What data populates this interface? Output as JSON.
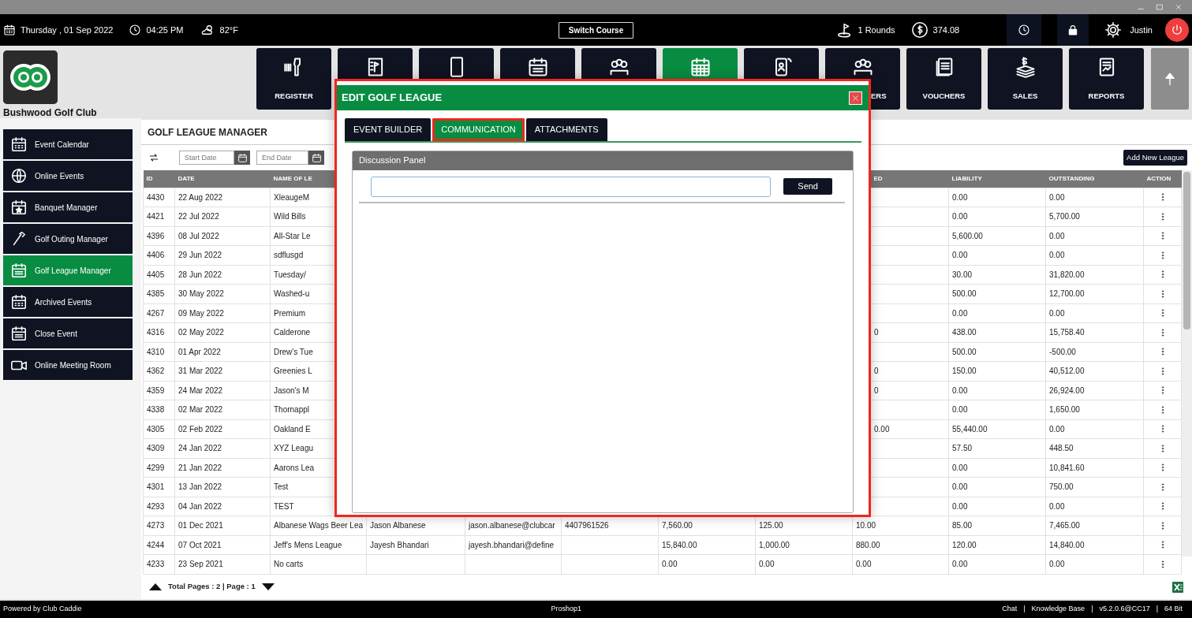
{
  "top_bar": {
    "date": "Thursday , 01 Sep 2022",
    "time": "04:25 PM",
    "temperature": "82°F",
    "switch_button": "Switch Course",
    "rounds": "1 Rounds",
    "balance": "374.08",
    "user": "Justin"
  },
  "club": {
    "name": "Bushwood Golf Club"
  },
  "nav_tiles": [
    {
      "label": "REGISTER",
      "selected": false
    },
    {
      "selected": false
    },
    {
      "selected": false
    },
    {
      "selected": false
    },
    {
      "selected": false
    },
    {
      "selected": true
    },
    {
      "selected": false
    },
    {
      "label": "ERS",
      "selected": false
    },
    {
      "label": "VOUCHERS",
      "selected": false
    },
    {
      "label": "SALES",
      "selected": false
    },
    {
      "label": "REPORTS",
      "selected": false
    }
  ],
  "sidebar": {
    "items": [
      {
        "label": "Event Calendar",
        "selected": false
      },
      {
        "label": "Online Events",
        "selected": false
      },
      {
        "label": "Banquet Manager",
        "selected": false
      },
      {
        "label": "Golf Outing Manager",
        "selected": false
      },
      {
        "label": "Golf League Manager",
        "selected": true
      },
      {
        "label": "Archived Events",
        "selected": false
      },
      {
        "label": "Close Event",
        "selected": false
      },
      {
        "label": "Online Meeting Room",
        "selected": false
      }
    ]
  },
  "panel": {
    "title": "GOLF LEAGUE MANAGER",
    "start_date": {
      "placeholder": "Start Date"
    },
    "end_date": {
      "placeholder": "End Date"
    },
    "add_button": "Add New League"
  },
  "table": {
    "columns": [
      "ID",
      "DATE",
      "NAME OF LE",
      null,
      null,
      null,
      null,
      null,
      "ED",
      "LIABILITY",
      "OUTSTANDING",
      "ACTION"
    ],
    "rows": [
      {
        "cells": [
          "4430",
          "22 Aug 2022",
          "XleaugeM",
          null,
          null,
          null,
          null,
          null,
          null,
          "0.00",
          "0.00"
        ]
      },
      {
        "cells": [
          "4421",
          "22 Jul 2022",
          "Wild Bills",
          null,
          null,
          null,
          null,
          null,
          null,
          "0.00",
          "5,700.00"
        ]
      },
      {
        "cells": [
          "4396",
          "08 Jul 2022",
          "All-Star Le",
          null,
          null,
          null,
          null,
          null,
          null,
          "5,600.00",
          "0.00"
        ]
      },
      {
        "cells": [
          "4406",
          "29 Jun 2022",
          "sdflusgd",
          null,
          null,
          null,
          null,
          null,
          null,
          "0.00",
          "0.00"
        ]
      },
      {
        "cells": [
          "4405",
          "28 Jun 2022",
          "Tuesday/",
          null,
          null,
          null,
          null,
          null,
          null,
          "30.00",
          "31,820.00"
        ]
      },
      {
        "cells": [
          "4385",
          "30 May 2022",
          "Washed-u",
          null,
          null,
          null,
          null,
          null,
          null,
          "500.00",
          "12,700.00"
        ]
      },
      {
        "cells": [
          "4267",
          "09 May 2022",
          "Premium",
          null,
          null,
          null,
          null,
          null,
          null,
          "0.00",
          "0.00"
        ]
      },
      {
        "cells": [
          "4316",
          "02 May 2022",
          "Calderone",
          null,
          null,
          null,
          null,
          null,
          "0",
          "438.00",
          "15,758.40"
        ]
      },
      {
        "cells": [
          "4310",
          "01 Apr 2022",
          "Drew's Tue",
          null,
          null,
          null,
          null,
          null,
          null,
          "500.00",
          "-500.00"
        ]
      },
      {
        "cells": [
          "4362",
          "31 Mar 2022",
          "Greenies L",
          null,
          null,
          null,
          null,
          null,
          "0",
          "150.00",
          "40,512.00"
        ]
      },
      {
        "cells": [
          "4359",
          "24 Mar 2022",
          "Jason's M",
          null,
          null,
          null,
          null,
          null,
          "0",
          "0.00",
          "26,924.00"
        ]
      },
      {
        "cells": [
          "4338",
          "02 Mar 2022",
          "Thornappl",
          null,
          null,
          null,
          null,
          null,
          null,
          "0.00",
          "1,650.00"
        ]
      },
      {
        "cells": [
          "4305",
          "02 Feb 2022",
          "Oakland E",
          null,
          null,
          null,
          null,
          null,
          "0.00",
          "55,440.00",
          "0.00"
        ]
      },
      {
        "cells": [
          "4309",
          "24 Jan 2022",
          "XYZ Leagu",
          null,
          null,
          null,
          null,
          null,
          null,
          "57.50",
          "448.50"
        ]
      },
      {
        "cells": [
          "4299",
          "21 Jan 2022",
          "Aarons Lea",
          null,
          null,
          null,
          null,
          null,
          null,
          "0.00",
          "10,841.60"
        ]
      },
      {
        "cells": [
          "4301",
          "13 Jan 2022",
          "Test",
          null,
          null,
          null,
          null,
          null,
          null,
          "0.00",
          "750.00"
        ]
      },
      {
        "cells": [
          "4293",
          "04 Jan 2022",
          "TEST",
          null,
          null,
          null,
          null,
          null,
          null,
          "0.00",
          "0.00"
        ]
      },
      {
        "cells": [
          "4273",
          "01 Dec 2021",
          "Albanese Wags Beer Lea",
          "Jason Albanese",
          "jason.albanese@clubcar",
          "4407961526",
          "7,560.00",
          "125.00",
          "10.00",
          "85.00",
          "7,465.00"
        ]
      },
      {
        "cells": [
          "4244",
          "07 Oct 2021",
          "Jeff's Mens League",
          "Jayesh Bhandari",
          "jayesh.bhandari@define",
          null,
          "15,840.00",
          "1,000.00",
          "880.00",
          "120.00",
          "14,840.00"
        ]
      },
      {
        "cells": [
          "4233",
          "23 Sep 2021",
          "No carts",
          null,
          null,
          null,
          "0.00",
          "0.00",
          "0.00",
          "0.00",
          "0.00"
        ]
      }
    ]
  },
  "pagination": {
    "text": "Total Pages : 2 | Page : 1"
  },
  "status_bar": {
    "left": "Powered by Club Caddie",
    "center": "Proshop1",
    "links": [
      "Chat",
      "Knowledge Base"
    ],
    "version": "v5.2.0.6@CC17",
    "bits": "64 Bit",
    "separator": "|"
  },
  "modal": {
    "title": "EDIT GOLF LEAGUE",
    "tabs": [
      {
        "label": "EVENT BUILDER",
        "selected": false
      },
      {
        "label": "COMMUNICATION",
        "selected": true
      },
      {
        "label": "ATTACHMENTS",
        "selected": false
      }
    ],
    "panel_title": "Discussion Panel",
    "send_button": "Send"
  }
}
